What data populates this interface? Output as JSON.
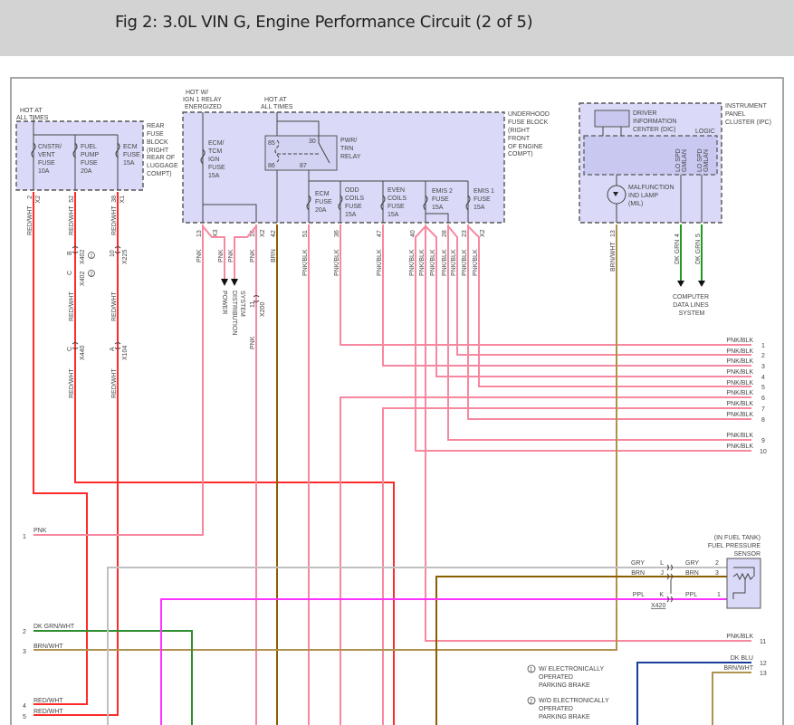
{
  "header": {
    "title": "Fig 2: 3.0L VIN G, Engine Performance Circuit (2 of 5)"
  },
  "colors": {
    "fuse_block_fill": "#dadaf8",
    "pnk": "#f7889f",
    "red_wht": "#ff2a2a",
    "brn": "#8b5e00",
    "brn_wht": "#b0924f",
    "gry": "#c0c0c0",
    "ppl": "#ff33ff",
    "dk_grn_wht": "#2f8f2f",
    "dk_grn": "#1e9a1e",
    "dk_blu": "#1a3c9a"
  },
  "rear_fuse_block": {
    "hot": [
      "HOT AT",
      "ALL TIMES"
    ],
    "name": [
      "REAR",
      "FUSE",
      "BLOCK",
      "(RIGHT",
      "REAR OF",
      "LUGGAGE",
      "COMPT)"
    ],
    "fuses": [
      [
        "CNSTR/",
        "VENT",
        "FUSE",
        "10A"
      ],
      [
        "FUEL",
        "PUMP",
        "FUSE",
        "20A"
      ],
      [
        "ECM",
        "FUSE",
        "15A"
      ]
    ],
    "pins": [
      "2",
      "52",
      "38"
    ],
    "connectors": [
      "X2",
      "X1"
    ],
    "wire": "RED/WHT",
    "inline": {
      "b": "B",
      "x402": "X402",
      "c": "C",
      "p10": "10",
      "x225": "X225",
      "x440": "X440",
      "a": "A",
      "x104": "X104",
      "note1": "1",
      "note2": "2"
    }
  },
  "underhood_fuse_block": {
    "hot_ign": [
      "HOT W/",
      "IGN 1 RELAY",
      "ENERGIZED"
    ],
    "hot_all": [
      "HOT AT",
      "ALL TIMES"
    ],
    "name": [
      "UNDERHOOD",
      "FUSE BLOCK",
      "(RIGHT",
      "FRONT",
      "OF ENGINE",
      "COMPT)"
    ],
    "ecm_tcm_fuse": [
      "ECM/",
      "TCM",
      "IGN",
      "FUSE",
      "15A"
    ],
    "relay": {
      "name": [
        "PWR/",
        "TRN",
        "RELAY"
      ],
      "pins": [
        "85",
        "86",
        "30",
        "87"
      ]
    },
    "fuses": [
      [
        "ECM",
        "FUSE",
        "20A"
      ],
      [
        "ODD",
        "COILS",
        "FUSE",
        "15A"
      ],
      [
        "EVEN",
        "COILS",
        "FUSE",
        "15A"
      ],
      [
        "EMIS 2",
        "FUSE",
        "15A"
      ],
      [
        "EMIS 1",
        "FUSE",
        "15A"
      ]
    ],
    "pins": [
      "13",
      "16",
      "42",
      "51",
      "36",
      "47",
      "40",
      "28",
      "23"
    ],
    "connectors": [
      "X3",
      "X2",
      "X2"
    ],
    "wires": {
      "pnk": "PNK",
      "brn": "BRN",
      "pnkblk": "PNK/BLK"
    },
    "power_dist": [
      "POWER",
      "DISTRIBUTION",
      "SYSTEM"
    ],
    "x200": {
      "pin": "11",
      "name": "X200"
    }
  },
  "ipc": {
    "name": [
      "INSTRUMENT",
      "PANEL",
      "CLUSTER (IPC)"
    ],
    "dic": [
      "DRIVER",
      "INFORMATION",
      "CENTER (DIC)"
    ],
    "logic": "LOGIC",
    "gmlan": [
      "LO SPD",
      "GMLAN"
    ],
    "mil": [
      "MALFUNCTION",
      "IND LAMP",
      "(MIL)"
    ],
    "pins": [
      "13",
      "4",
      "5"
    ],
    "wires": [
      "BRN/WHT",
      "DK GRN",
      "DK GRN"
    ],
    "data_lines": [
      "COMPUTER",
      "DATA LINES",
      "SYSTEM"
    ]
  },
  "right_rows": [
    {
      "num": "1",
      "wire": "PNK/BLK"
    },
    {
      "num": "2",
      "wire": "PNK/BLK"
    },
    {
      "num": "3",
      "wire": "PNK/BLK"
    },
    {
      "num": "4",
      "wire": "PNK/BLK"
    },
    {
      "num": "5",
      "wire": "PNK/BLK"
    },
    {
      "num": "6",
      "wire": "PNK/BLK"
    },
    {
      "num": "7",
      "wire": "PNK/BLK"
    },
    {
      "num": "8",
      "wire": "PNK/BLK"
    },
    {
      "num": "9",
      "wire": "PNK/BLK"
    },
    {
      "num": "10",
      "wire": "PNK/BLK"
    },
    {
      "num": "11",
      "wire": "PNK/BLK"
    },
    {
      "num": "12",
      "wire": "DK BLU"
    },
    {
      "num": "13",
      "wire": "BRN/WHT"
    }
  ],
  "left_rows": [
    {
      "num": "1",
      "wire": "PNK"
    },
    {
      "num": "2",
      "wire": "DK GRN/WHT"
    },
    {
      "num": "3",
      "wire": "BRN/WHT"
    },
    {
      "num": "4",
      "wire": "RED/WHT"
    },
    {
      "num": "5",
      "wire": "RED/WHT"
    }
  ],
  "sensor": {
    "name": [
      "(IN FUEL TANK)",
      "FUEL PRESSURE",
      "SENSOR"
    ],
    "pins": [
      "2",
      "3",
      "1"
    ],
    "wires": [
      "GRY",
      "BRN",
      "PPL"
    ],
    "connector": {
      "pins": [
        "L",
        "J",
        "K"
      ],
      "name": "X420"
    }
  },
  "notes": [
    {
      "mark": "1",
      "lines": [
        "W/ ELECTRONICALLY",
        "OPERATED",
        "PARKING BRAKE"
      ]
    },
    {
      "mark": "2",
      "lines": [
        "W/O ELECTRONICALLY",
        "OPERATED",
        "PARKING BRAKE"
      ]
    }
  ]
}
